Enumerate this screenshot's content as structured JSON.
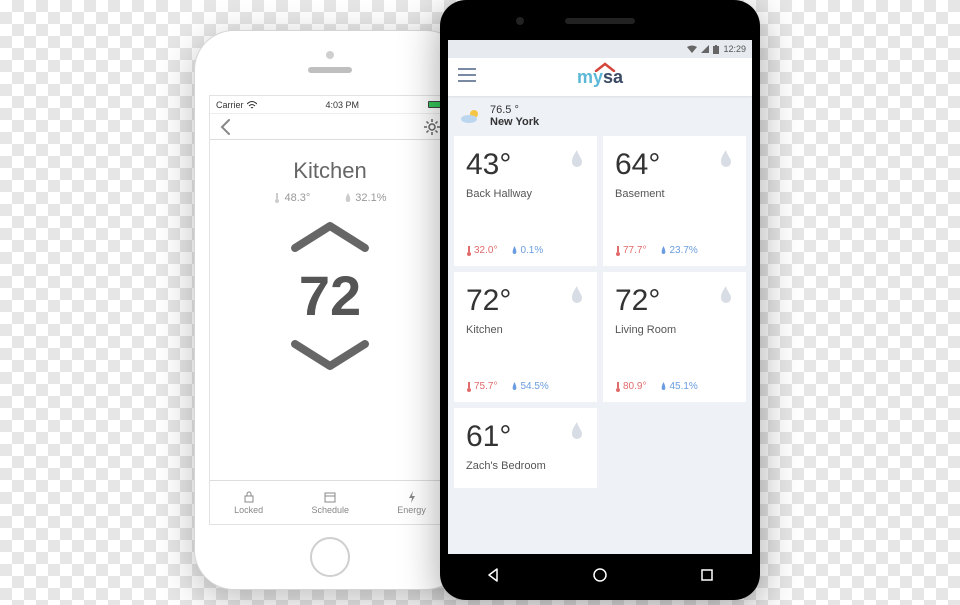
{
  "iphone": {
    "statusbar": {
      "carrier": "Carrier",
      "time": "4:03 PM"
    },
    "room": {
      "title": "Kitchen",
      "temp_reading": "48.3°",
      "humidity_reading": "32.1%",
      "setpoint": "72"
    },
    "bottombar": {
      "locked": "Locked",
      "schedule": "Schedule",
      "energy": "Energy"
    }
  },
  "android": {
    "statusbar": {
      "time": "12:29"
    },
    "logo": {
      "my": "my",
      "sa": "sa"
    },
    "weather": {
      "temp": "76.5 °",
      "city": "New York"
    },
    "rooms": [
      {
        "setpoint": "43°",
        "name": "Back Hallway",
        "temp": "32.0°",
        "humidity": "0.1%"
      },
      {
        "setpoint": "64°",
        "name": "Basement",
        "temp": "77.7°",
        "humidity": "23.7%"
      },
      {
        "setpoint": "72°",
        "name": "Kitchen",
        "temp": "75.7°",
        "humidity": "54.5%"
      },
      {
        "setpoint": "72°",
        "name": "Living Room",
        "temp": "80.9°",
        "humidity": "45.1%"
      },
      {
        "setpoint": "61°",
        "name": "Zach's Bedroom",
        "temp": "",
        "humidity": ""
      }
    ]
  }
}
